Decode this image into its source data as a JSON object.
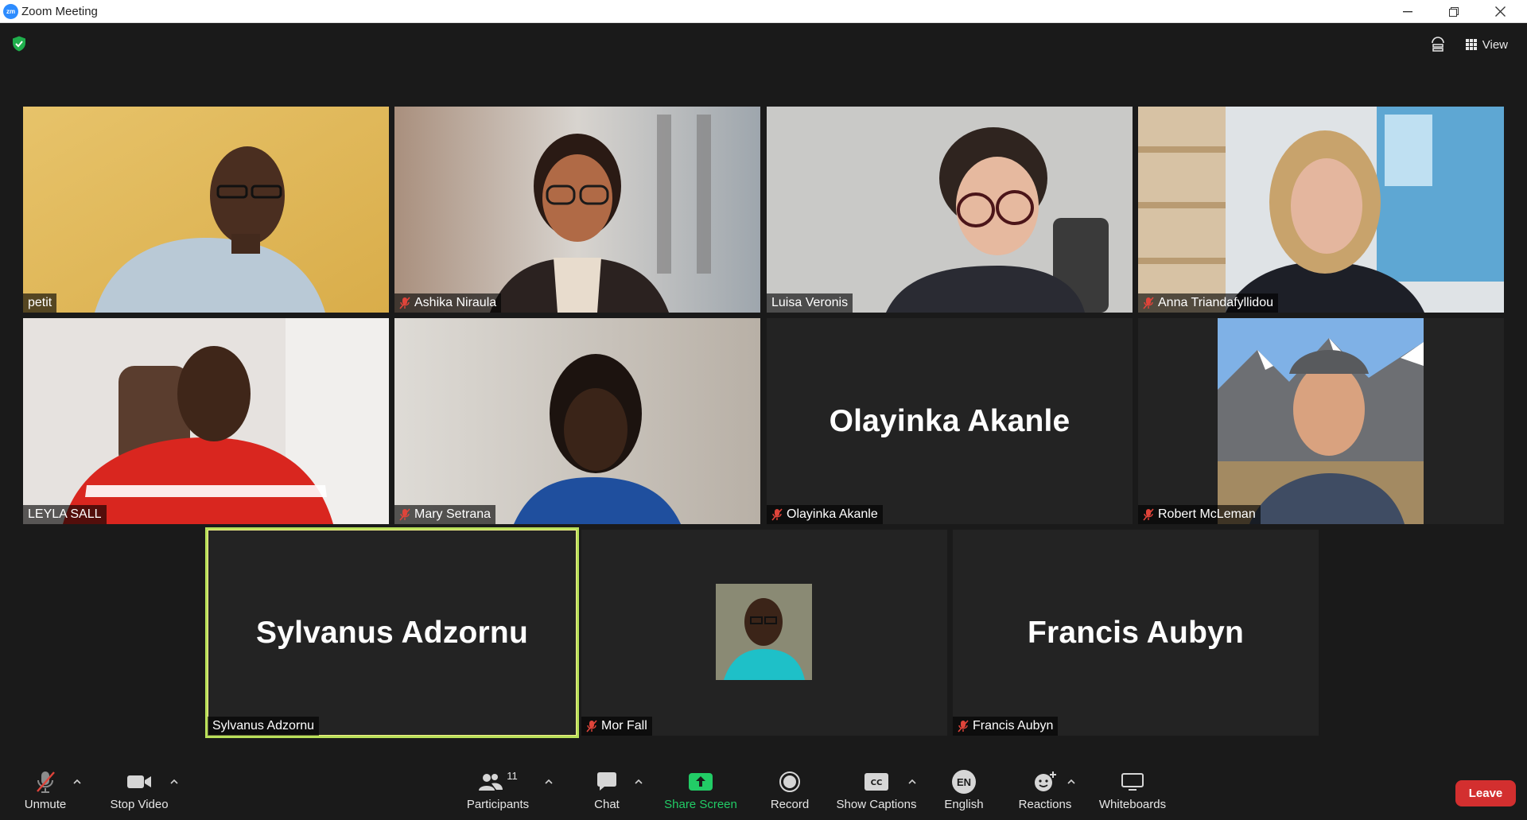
{
  "window": {
    "app_logo_text": "zm",
    "title": "Zoom Meeting"
  },
  "top_bar": {
    "view_label": "View"
  },
  "tiles": [
    {
      "name": "petit",
      "muted": false,
      "mode": "video"
    },
    {
      "name": "Ashika Niraula",
      "muted": true,
      "mode": "video"
    },
    {
      "name": "Luisa Veronis",
      "muted": false,
      "mode": "video"
    },
    {
      "name": "Anna Triandafyllidou",
      "muted": true,
      "mode": "video"
    },
    {
      "name": "LEYLA SALL",
      "muted": false,
      "mode": "video"
    },
    {
      "name": "Mary Setrana",
      "muted": true,
      "mode": "video"
    },
    {
      "name": "Olayinka Akanle",
      "muted": true,
      "mode": "name",
      "display_name": "Olayinka Akanle"
    },
    {
      "name": "Robert McLeman",
      "muted": true,
      "mode": "video"
    },
    {
      "name": "Sylvanus Adzornu",
      "muted": false,
      "mode": "name",
      "display_name": "Sylvanus Adzornu",
      "active_speaker": true
    },
    {
      "name": "Mor Fall",
      "muted": true,
      "mode": "avatar"
    },
    {
      "name": "Francis Aubyn",
      "muted": true,
      "mode": "name",
      "display_name": "Francis Aubyn"
    }
  ],
  "toolbar": {
    "unmute": "Unmute",
    "stop_video": "Stop Video",
    "participants": "Participants",
    "participants_count": "11",
    "chat": "Chat",
    "share_screen": "Share Screen",
    "record": "Record",
    "show_captions": "Show Captions",
    "language_code": "EN",
    "english": "English",
    "reactions": "Reactions",
    "whiteboards": "Whiteboards",
    "leave": "Leave"
  },
  "colors": {
    "active_speaker_border": "#b9e05a",
    "share_green": "#22cc66",
    "leave_red": "#d32f2f",
    "mute_red": "#e0443a",
    "brand_blue": "#2d8cff"
  }
}
